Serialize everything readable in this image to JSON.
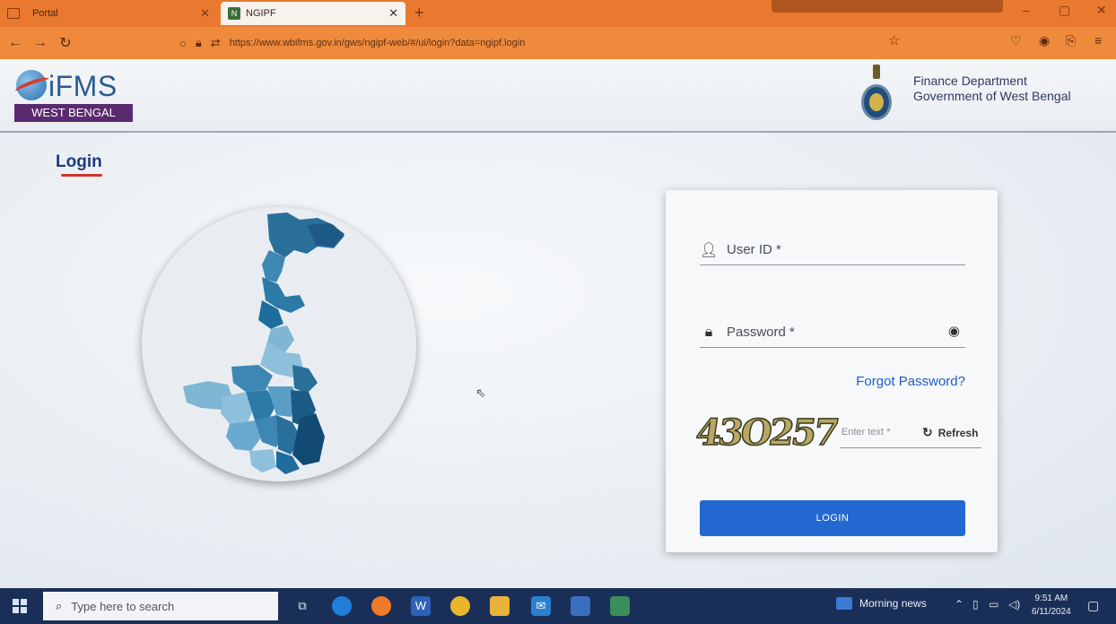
{
  "browser": {
    "tabs": [
      {
        "label": "Portal",
        "active": false
      },
      {
        "label": "NGIPF",
        "active": true,
        "icon_text": "N"
      }
    ],
    "url": "https://www.wbifms.gov.in/gws/ngipf-web/#/ui/login?data=ngipf.login"
  },
  "header": {
    "logo_text": "iFMS",
    "logo_subtitle": "WEST BENGAL",
    "dept_line1": "Finance Department",
    "dept_line2": "Government of West Bengal"
  },
  "page": {
    "title": "Login"
  },
  "login_form": {
    "user_label": "User ID *",
    "password_label": "Password *",
    "forgot_password": "Forgot Password?",
    "captcha_text": "43O257",
    "captcha_placeholder": "Enter text *",
    "refresh_label": "Refresh",
    "login_button": "LOGIN"
  },
  "taskbar": {
    "search_placeholder": "Type here to search",
    "news_label": "Morning news",
    "time": "9:51 AM",
    "date": "6/11/2024"
  },
  "colors": {
    "browser_orange": "#ef8a3c",
    "primary_blue": "#2368d0",
    "login_title_blue": "#1d3b7a",
    "underline_red": "#d0342c",
    "taskbar_navy": "#1a2f57"
  }
}
